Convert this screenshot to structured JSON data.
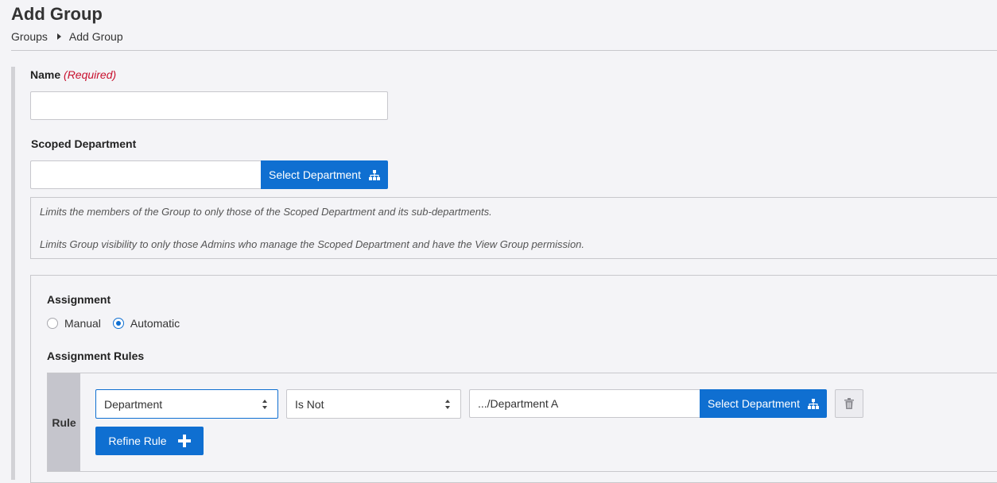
{
  "header": {
    "title": "Add Group",
    "breadcrumb": [
      "Groups",
      "Add Group"
    ]
  },
  "form": {
    "name": {
      "label": "Name",
      "required_text": "(Required)",
      "value": ""
    },
    "scoped_department": {
      "label": "Scoped Department",
      "value": "",
      "button_label": "Select Department",
      "button_icon": "sitemap-icon",
      "info": [
        "Limits the members of the Group to only those of the Scoped Department and its sub-departments.",
        "Limits Group visibility to only those Admins who manage the Scoped Department and have the View Group permission."
      ]
    },
    "assignment": {
      "label": "Assignment",
      "options": [
        "Manual",
        "Automatic"
      ],
      "selected": "Automatic"
    },
    "assignment_rules": {
      "label": "Assignment Rules",
      "rule": {
        "label": "Rule",
        "field": "Department",
        "operator": "Is Not",
        "value": ".../Department A",
        "select_button_label": "Select Department",
        "refine_button_label": "Refine Rule"
      }
    }
  },
  "colors": {
    "accent": "#0f6fd1",
    "required": "#c8102e",
    "background": "#f4f4f7"
  }
}
